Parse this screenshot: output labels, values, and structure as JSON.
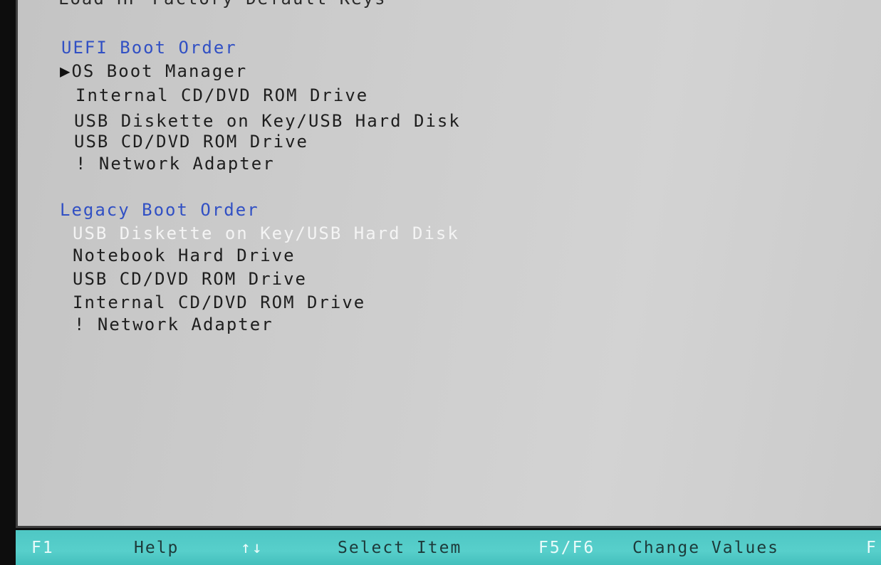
{
  "top_partial_text": "Load HP Factory Default Keys",
  "uefi_boot_order": {
    "heading": "UEFI Boot Order",
    "selector_glyph": "▶",
    "items": [
      "OS Boot Manager",
      "Internal CD/DVD ROM Drive",
      "USB Diskette on Key/USB Hard Disk",
      "USB CD/DVD ROM Drive",
      "! Network Adapter"
    ]
  },
  "legacy_boot_order": {
    "heading": "Legacy Boot Order",
    "items": [
      "USB Diskette on Key/USB Hard Disk",
      "Notebook Hard Drive",
      "USB CD/DVD ROM Drive",
      "Internal CD/DVD ROM Drive",
      "! Network Adapter"
    ]
  },
  "footer": {
    "items": [
      {
        "key": "F1",
        "desc": "Help"
      },
      {
        "key": "↑↓",
        "desc": "Select Item"
      },
      {
        "key": "F5/F6",
        "desc": "Change Values"
      },
      {
        "key": "F",
        "desc": ""
      }
    ]
  },
  "colors": {
    "heading_blue": "#3150c4",
    "highlight_text": "#f4f4f4",
    "footer_bar": "#52cac7",
    "panel_gray": "#cdcdcd"
  }
}
